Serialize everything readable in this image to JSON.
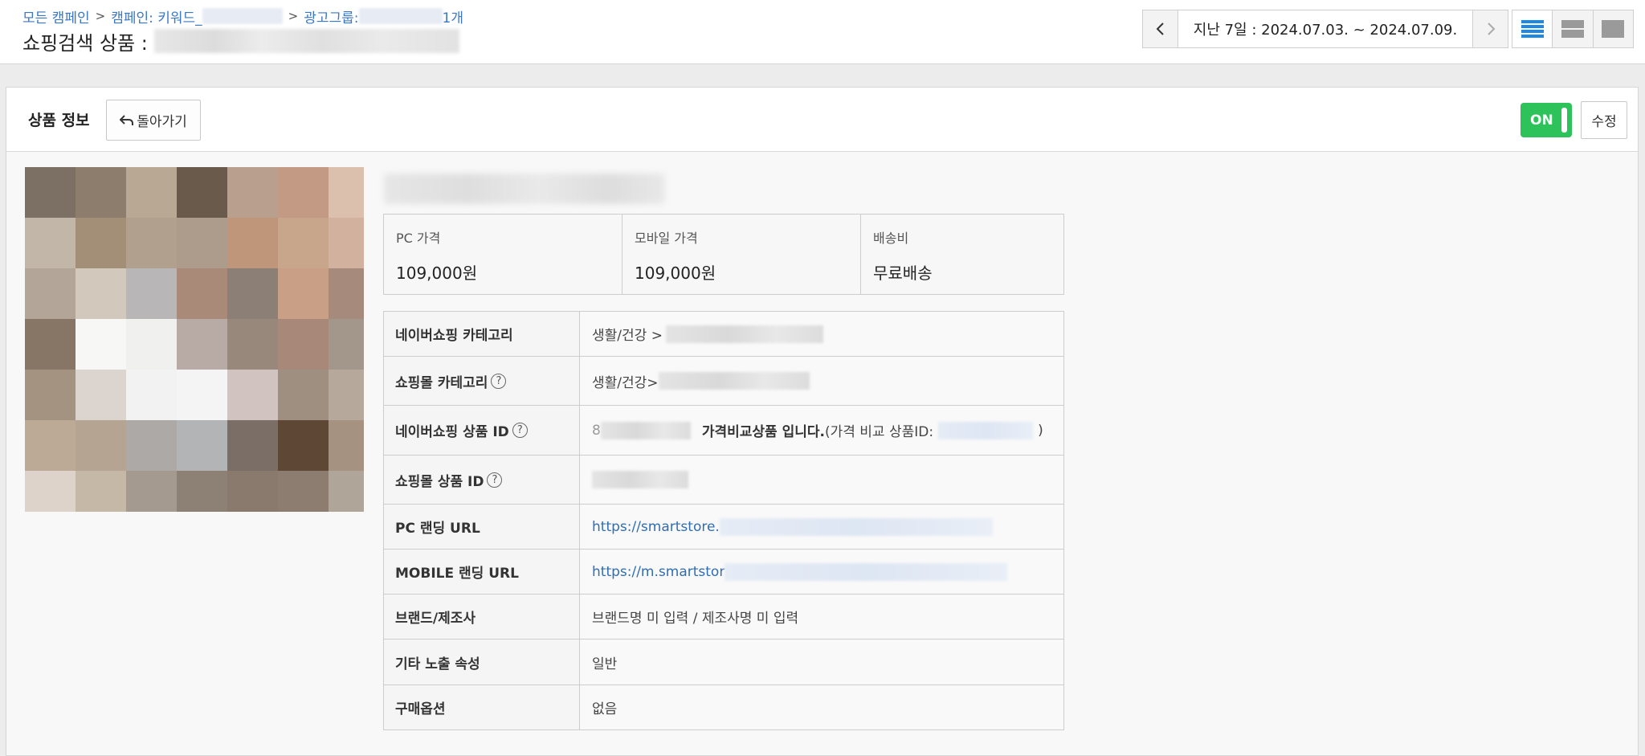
{
  "header": {
    "breadcrumb": {
      "all_campaigns": "모든 캠페인",
      "campaign_prefix": "캠페인: 키워드_",
      "adgroup_prefix": "광고그룹: ",
      "adgroup_suffix": "1개"
    },
    "title_prefix": "쇼핑검색 상품 :",
    "date_range": "지난 7일 : 2024.07.03. ~ 2024.07.09.",
    "icons": {
      "prev": "chevron-left-icon",
      "next": "chevron-right-icon",
      "view1": "list-view-icon",
      "view2": "split-view-icon",
      "view3": "single-view-icon"
    }
  },
  "panel": {
    "title": "상품 정보",
    "back_label": "돌아가기",
    "toggle_label": "ON",
    "edit_label": "수정",
    "colors": {
      "toggle_on": "#2ec25b",
      "link": "#2f6db5",
      "active_view": "#1e88e5"
    }
  },
  "prices": [
    {
      "label": "PC 가격",
      "value": "109,000원"
    },
    {
      "label": "모바일 가격",
      "value": "109,000원"
    },
    {
      "label": "배송비",
      "value": "무료배송"
    }
  ],
  "info": {
    "naver_category": {
      "label": "네이버쇼핑 카테고리",
      "value": "생활/건강 >"
    },
    "mall_category": {
      "label": "쇼핑몰 카테고리",
      "value": "생활/건강>"
    },
    "naver_product_id": {
      "label": "네이버쇼핑 상품 ID",
      "id_prefix": "8",
      "compare_text": "가격비교상품 입니다.",
      "compare_id_label": "(가격 비교 상품ID:",
      "compare_close": ")"
    },
    "mall_product_id": {
      "label": "쇼핑몰 상품 ID"
    },
    "pc_url": {
      "label": "PC 랜딩 URL",
      "value": "https://smartstore."
    },
    "mobile_url": {
      "label": "MOBILE 랜딩 URL",
      "value": "https://m.smartstor"
    },
    "brand": {
      "label": "브랜드/제조사",
      "value": "브랜드명 미 입력 / 제조사명 미 입력"
    },
    "exposure": {
      "label": "기타 노출 속성",
      "value": "일반"
    },
    "options": {
      "label": "구매옵션",
      "value": "없음"
    },
    "help_glyph": "?"
  },
  "image_palette": [
    "#7c6f63",
    "#8c7d6d",
    "#b9a994",
    "#6a5a4b",
    "#b9a08e",
    "#c39b84",
    "#dbc0ad",
    "#c2b6a9",
    "#a38e78",
    "#b0a08d",
    "#ad9c8b",
    "#bf9679",
    "#c8a68c",
    "#d3b19f",
    "#b3a598",
    "#d2c9bc",
    "#b8b6b7",
    "#a98a79",
    "#8c7f76",
    "#c9a086",
    "#a68b7d",
    "#877565",
    "#f7f7f5",
    "#f0f0ef",
    "#b8aaa5",
    "#98887b",
    "#a88979",
    "#a2978a",
    "#a49380",
    "#dbd4cf",
    "#f2f2f2",
    "#f4f4f4",
    "#d1c4c0",
    "#9f8f80",
    "#b6a89a",
    "#bcaa97",
    "#b5a492",
    "#aca9a6",
    "#b3b4b5",
    "#7b6e66",
    "#5e4734",
    "#a59281",
    "#ddd3cb",
    "#c6b8a7",
    "#a49a90",
    "#8d8175",
    "#8a7a6e",
    "#8c7d70",
    "#b0a599"
  ]
}
